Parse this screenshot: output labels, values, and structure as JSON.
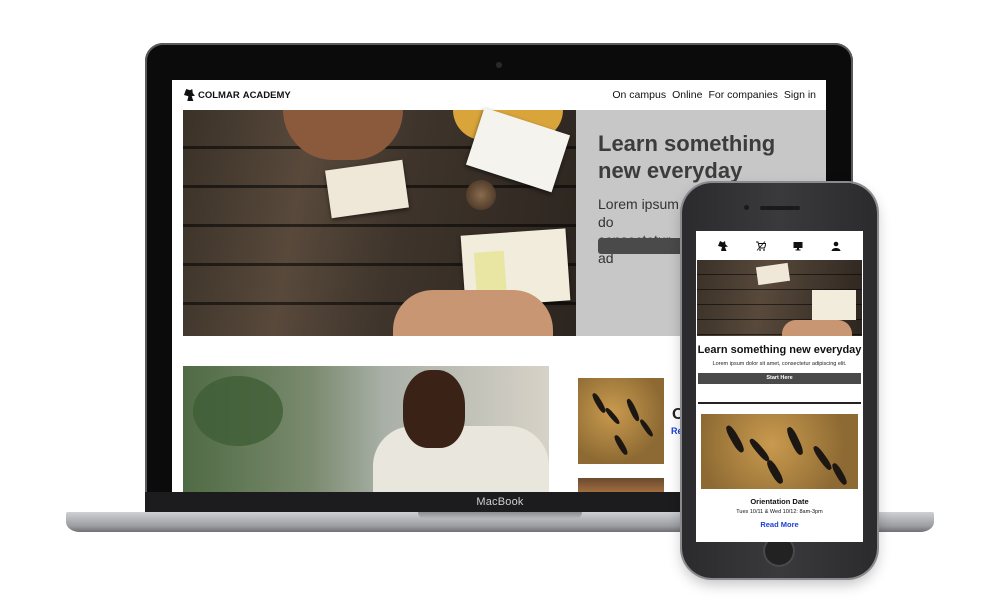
{
  "desktop": {
    "logo_bold": "COLMAR",
    "logo_rest": "ACADEMY",
    "nav": [
      "On campus",
      "Online",
      "For companies",
      "Sign in"
    ],
    "hero_title": "Learn something new everyday",
    "hero_text": "Lorem ipsum do consectetur ad",
    "thumb_heading": "O",
    "thumb_link": "Rea"
  },
  "device_label": "MacBook",
  "mobile": {
    "icons": [
      "logo-icon",
      "cart-icon",
      "monitor-icon",
      "user-icon"
    ],
    "hero_title": "Learn something new everyday",
    "hero_text": "Lorem ipsum dolor sit amet, consectetur adipiscing elit.",
    "button_label": "Start Here",
    "card_title": "Orientation Date",
    "card_dates": "Tues 10/11 & Wed 10/12: 8am-3pm",
    "card_link": "Read More"
  }
}
